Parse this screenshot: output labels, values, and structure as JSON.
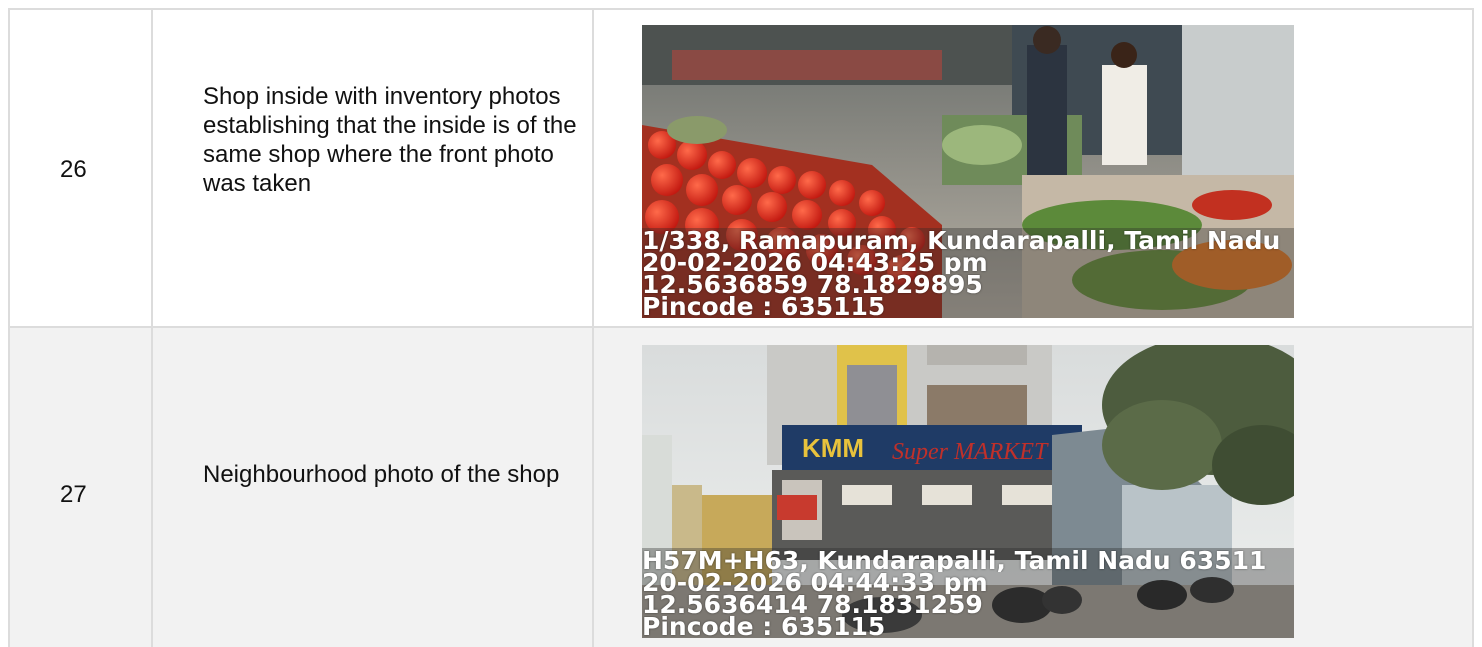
{
  "rows": [
    {
      "number": "26",
      "description": "Shop inside with inventory photos establishing that the inside is of the same shop where the front photo was taken",
      "photo": {
        "address": "1/338, Ramapuram, Kundarapalli, Tamil Nadu",
        "datetime": "20-02-2026 04:43:25 pm",
        "coords": "12.5636859 78.1829895",
        "pincode": "Pincode : 635115"
      }
    },
    {
      "number": "27",
      "description": "Neighbourhood photo of the shop",
      "photo": {
        "address": "H57M+H63, Kundarapalli, Tamil Nadu 63511",
        "datetime": "20-02-2026 04:44:33 pm",
        "coords": "12.5636414 78.1831259",
        "pincode": "Pincode : 635115",
        "sign_text": "Super MARKET"
      }
    }
  ]
}
